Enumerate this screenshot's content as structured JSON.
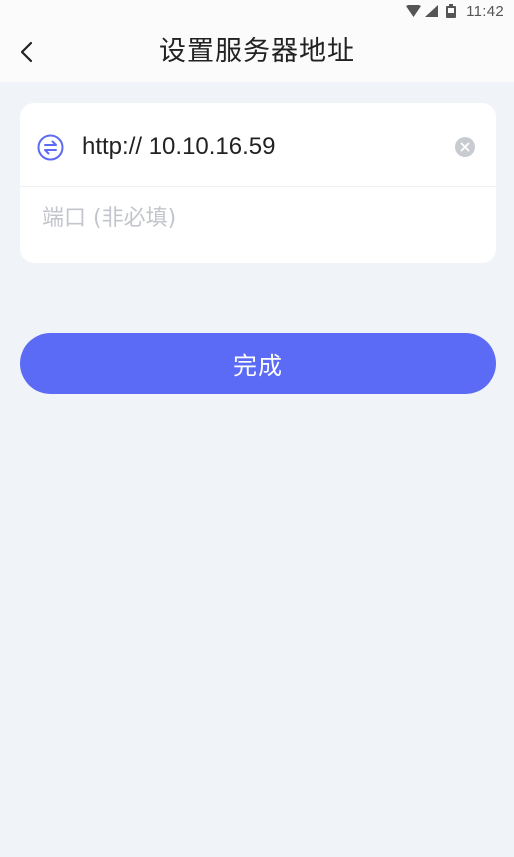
{
  "status_bar": {
    "time": "11:42",
    "icons": [
      "wifi-icon",
      "signal-icon",
      "battery-icon"
    ]
  },
  "header": {
    "back_icon": "chevron-left-icon",
    "title": "设置服务器地址"
  },
  "form": {
    "url_value": "http:// 10.10.16.59",
    "port_value": "",
    "port_placeholder": "端口 (非必填)",
    "swap_icon": "swap-icon",
    "clear_icon": "clear-icon"
  },
  "actions": {
    "done_label": "完成"
  },
  "colors": {
    "accent": "#5b6bf6",
    "background": "#f0f3f7",
    "card": "#ffffff",
    "header": "#fbfbfb"
  }
}
